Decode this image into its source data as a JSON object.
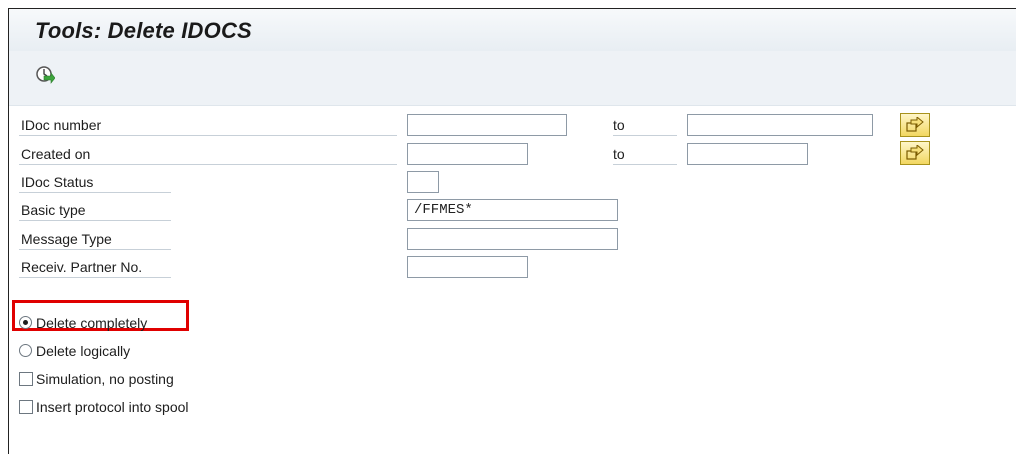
{
  "title": "Tools: Delete IDOCS",
  "toolbar": {
    "execute_icon": "execute-clock-icon"
  },
  "fields": {
    "idoc_number": {
      "label": "IDoc number",
      "from": "",
      "to_label": "to",
      "to": ""
    },
    "created_on": {
      "label": "Created on",
      "from": "",
      "to_label": "to",
      "to": ""
    },
    "idoc_status": {
      "label": "IDoc Status",
      "value": ""
    },
    "basic_type": {
      "label": "Basic type",
      "value": "/FFMES*"
    },
    "message_type": {
      "label": "Message Type",
      "value": ""
    },
    "receiv_partner": {
      "label": "Receiv. Partner No.",
      "value": ""
    }
  },
  "options": {
    "delete_completely": {
      "label": "Delete completely",
      "selected": true
    },
    "delete_logically": {
      "label": "Delete logically",
      "selected": false
    },
    "simulation": {
      "label": "Simulation, no posting",
      "checked": false
    },
    "insert_protocol": {
      "label": "Insert protocol into spool",
      "checked": false
    }
  },
  "colors": {
    "highlight": "#e00000",
    "multiselect": "#f2d761"
  }
}
